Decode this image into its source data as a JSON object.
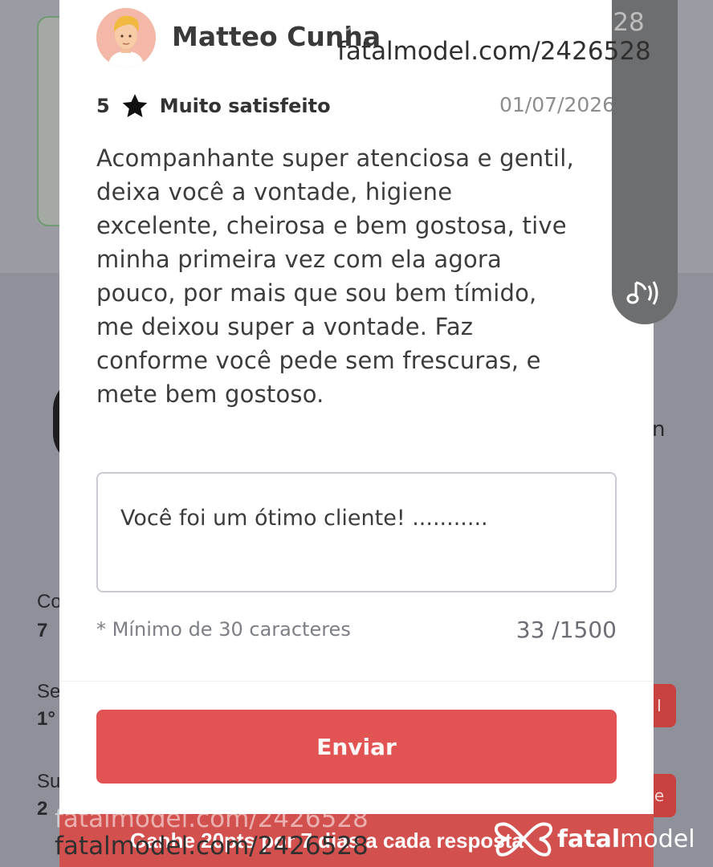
{
  "review": {
    "reviewer_name": "Matteo Cunha",
    "rating": "5",
    "rating_label": "Muito satisfeito",
    "date": "01/07/2026",
    "text": "Acompanhante super atenciosa e gentil, deixa você a vontade, higiene excelente, cheirosa e bem gostosa, tive minha primeira vez com ela agora pouco, por mais que sou bem tímido, me deixou super a vontade. Faz conforme você pede sem frescuras, e mete bem gostoso."
  },
  "reply": {
    "value": "Você foi um ótimo cliente! ...........",
    "min_hint": "* Mínimo de 30 caracteres",
    "char_count": "33 /1500",
    "send_label": "Enviar"
  },
  "background": {
    "banner_text": "Ganhe 20pts por 7 dias a cada resposta",
    "frag_1": "Co",
    "frag_2": "7",
    "frag_3": "Se",
    "frag_4": "1°",
    "frag_5": "Su",
    "frag_6": "2",
    "frag_7": "n"
  },
  "watermarks": {
    "top_main": "fatalmodel.com/2426528",
    "top_ghost": "fatalmodel.com/2426528",
    "bottom_main": "fatalmodel.com/2426528",
    "bottom_ghost": "fatalmodel.com/2426528"
  },
  "brand": {
    "bold": "fatal",
    "light": "model"
  },
  "icons": {
    "star": "star-icon",
    "audio": "music-note-sound-icon",
    "logo": "fatalmodel-logo-icon"
  },
  "colors": {
    "primary_red": "#e25454",
    "banner_red": "#d2504d"
  }
}
